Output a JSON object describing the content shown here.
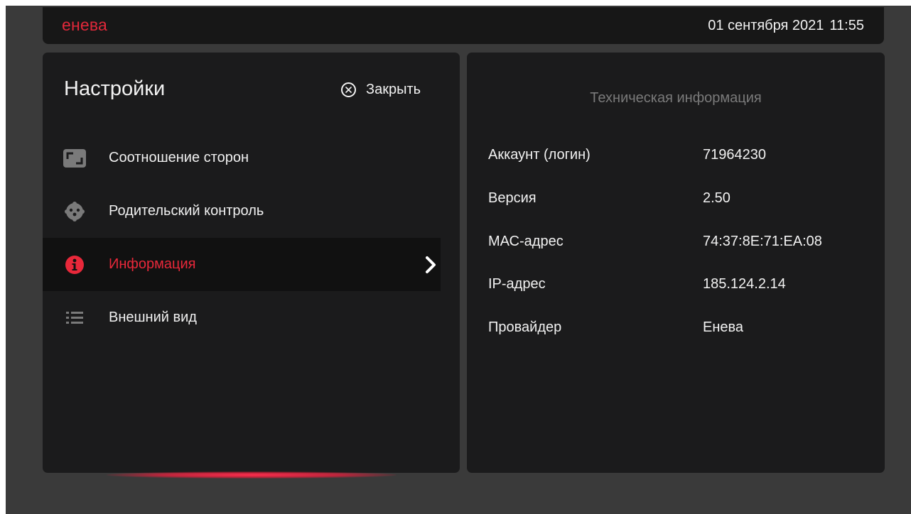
{
  "header": {
    "logo": "енева",
    "date": "01 сентября 2021",
    "time": "11:55"
  },
  "settings": {
    "title": "Настройки",
    "close_label": "Закрыть",
    "menu": [
      {
        "label": "Соотношение сторон",
        "icon": "aspect-ratio-icon",
        "active": false
      },
      {
        "label": "Родительский контроль",
        "icon": "parental-control-icon",
        "active": false
      },
      {
        "label": "Информация",
        "icon": "info-icon",
        "active": true
      },
      {
        "label": "Внешний вид",
        "icon": "list-icon",
        "active": false
      }
    ]
  },
  "tech_info": {
    "title": "Техническая информация",
    "rows": [
      {
        "label": "Аккаунт (логин)",
        "value": "71964230"
      },
      {
        "label": "Версия",
        "value": "2.50"
      },
      {
        "label": "МАС-адрес",
        "value": "74:37:8E:71:EA:08"
      },
      {
        "label": "IP-адрес",
        "value": "185.124.2.14"
      },
      {
        "label": "Провайдер",
        "value": "Енева"
      }
    ]
  },
  "colors": {
    "accent": "#e8283a",
    "panel_bg": "#1b1b1c",
    "page_bg": "#3a3a3a"
  }
}
